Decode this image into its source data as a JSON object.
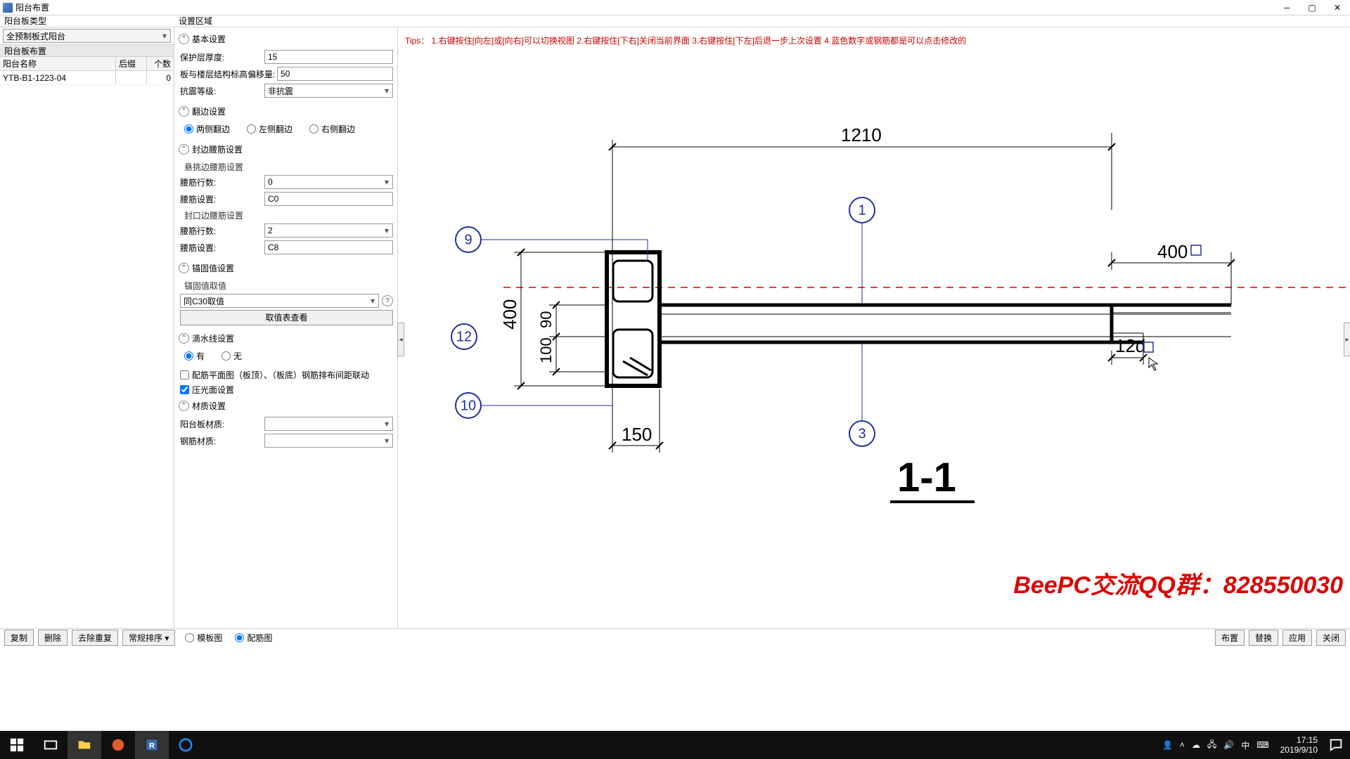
{
  "window": {
    "title": "阳台布置"
  },
  "left": {
    "type_label": "阳台板类型",
    "type_value": "全预制板式阳台",
    "list_header": "阳台板布置",
    "columns": {
      "name": "阳台名称",
      "suffix": "后缀",
      "count": "个数"
    },
    "rows": [
      {
        "name": "YTB-B1-1223-04",
        "suffix": "",
        "count": "0"
      }
    ]
  },
  "settings": {
    "header": "设置区域",
    "basic": {
      "title": "基本设置",
      "cover_label": "保护层厚度:",
      "cover_value": "15",
      "offset_label": "板与楼层结构标高偏移量:",
      "offset_value": "50",
      "seismic_label": "抗震等级:",
      "seismic_value": "非抗震"
    },
    "flip": {
      "title": "翻边设置",
      "opt_both": "两侧翻边",
      "opt_left": "左侧翻边",
      "opt_right": "右侧翻边"
    },
    "waist": {
      "title": "封边腰筋设置",
      "cantilever_sub": "悬挑边腰筋设置",
      "rows_label": "腰筋行数:",
      "cant_rows_value": "0",
      "spec_label": "腰筋设置:",
      "cant_spec_value": "C0",
      "closure_sub": "封口边腰筋设置",
      "clos_rows_value": "2",
      "clos_spec_value": "C8"
    },
    "anchorage": {
      "title": "锚固值设置",
      "source_label": "锚固值取值",
      "source_value": "同C30取值",
      "view_btn": "取值表查看"
    },
    "drip": {
      "title": "滴水线设置",
      "opt_yes": "有",
      "opt_no": "无"
    },
    "rebar_link": "配筋平面图（板顶）、（板底）钢筋排布间距联动",
    "press_face": "压光面设置",
    "material": {
      "title": "材质设置",
      "slab_label": "阳台板材质:",
      "rebar_label": "钢筋材质:"
    }
  },
  "canvas": {
    "tips": "Tips：  1.右键按住[向左]或[向右]可以切换视图 2.右键按住[下右]关闭当前界面 3.右键按住[下左]后退一步上次设置 4.蓝色数字或钢筋都是可以点击修改的",
    "dim_top": "1210",
    "dim_h1": "400",
    "dim_v1": "90",
    "dim_v2": "100",
    "dim_r1": "400",
    "dim_r2": "12d",
    "dim_bottom": "150",
    "bubble1": "1",
    "bubble3": "3",
    "bubble9": "9",
    "bubble10": "10",
    "bubble12": "12",
    "section_title": "1-1"
  },
  "watermark": "BeePC交流QQ群：828550030",
  "footer": {
    "copy": "复制",
    "delete": "删除",
    "dedup": "去除重复",
    "sort": "常规排序",
    "view_template": "模板图",
    "view_rebar": "配筋图",
    "btn_layout": "布置",
    "btn_replace": "替换",
    "btn_apply": "应用",
    "btn_close": "关闭"
  },
  "taskbar": {
    "time": "17:15",
    "date": "2019/9/10"
  }
}
